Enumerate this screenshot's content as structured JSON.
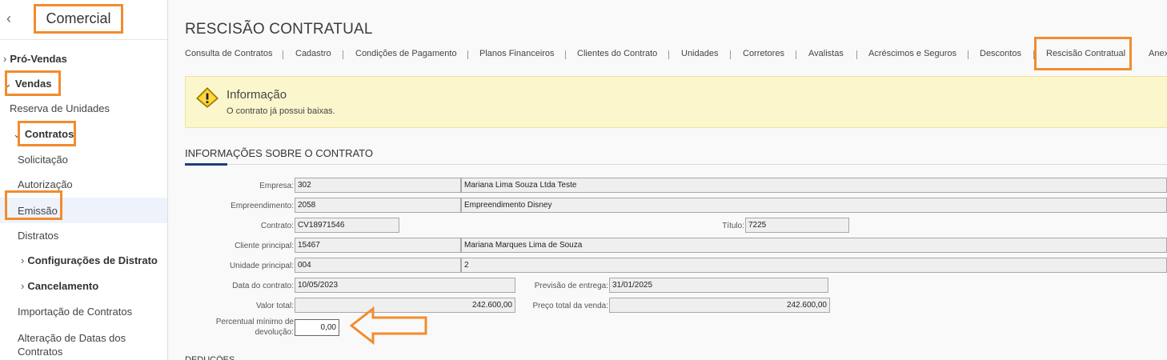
{
  "sidebar": {
    "app_title": "Comercial",
    "items": [
      {
        "label": "Pró-Vendas"
      },
      {
        "label": "Vendas"
      },
      {
        "label": "Reserva de Unidades"
      },
      {
        "label": "Contratos"
      },
      {
        "label": "Solicitação"
      },
      {
        "label": "Autorização"
      },
      {
        "label": "Emissão"
      },
      {
        "label": "Distratos"
      },
      {
        "label": "Configurações de Distrato"
      },
      {
        "label": "Cancelamento"
      },
      {
        "label": "Importação de Contratos"
      },
      {
        "label": "Alteração de Datas dos"
      },
      {
        "label": "Contratos"
      }
    ]
  },
  "page": {
    "title": "RESCISÃO CONTRATUAL"
  },
  "tabs": [
    "Consulta de Contratos",
    "Cadastro",
    "Condições de Pagamento",
    "Planos Financeiros",
    "Clientes do Contrato",
    "Unidades",
    "Corretores",
    "Avalistas",
    "Acréscimos e Seguros",
    "Descontos",
    "Rescisão Contratual",
    "Anex"
  ],
  "info": {
    "title": "Informação",
    "text": "O contrato já possui baixas."
  },
  "section": {
    "title": "INFORMAÇÕES SOBRE O CONTRATO",
    "next_title": "DEDUÇÕES"
  },
  "form": {
    "empresa_label": "Empresa:",
    "empresa_code": "302",
    "empresa_name": "Mariana  Lima Souza Ltda Teste",
    "empreendimento_label": "Empreendimento:",
    "empreendimento_code": "2058",
    "empreendimento_name": "Empreendimento Disney",
    "contrato_label": "Contrato:",
    "contrato_value": "CV18971546",
    "titulo_label": "Título:",
    "titulo_value": "7225",
    "cliente_label": "Cliente principal:",
    "cliente_code": "15467",
    "cliente_name": "Mariana Marques Lima de Souza",
    "unidade_label": "Unidade principal:",
    "unidade_code": "004",
    "unidade_name": "2",
    "data_contrato_label": "Data do contrato:",
    "data_contrato_value": "10/05/2023",
    "previsao_label": "Previsão de entrega:",
    "previsao_value": "31/01/2025",
    "valor_total_label": "Valor total:",
    "valor_total_value": "242.600,00",
    "preco_total_label": "Preço total da venda:",
    "preco_total_value": "242.600,00",
    "percentual_label_1": "Percentual mínimo de",
    "percentual_label_2": "devolução:",
    "percentual_value": "0,00"
  },
  "colors": {
    "highlight": "#f28c2e",
    "info_bg": "#fcf6cc",
    "accent": "#1f3d7a"
  }
}
